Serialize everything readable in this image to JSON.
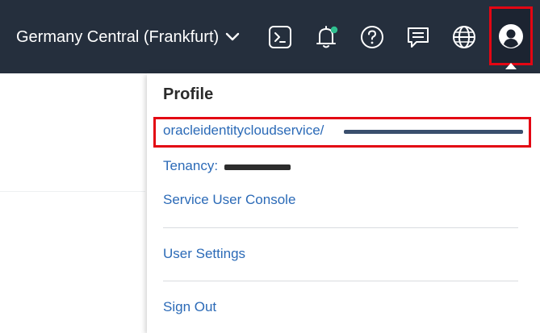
{
  "header": {
    "region_label": "Germany Central (Frankfurt)",
    "icons": [
      "cloud-shell-icon",
      "notifications-icon",
      "help-icon",
      "chat-icon",
      "language-icon",
      "profile-icon"
    ],
    "notification_dot_color": "#2fbf8f",
    "highlight_color": "#e30613"
  },
  "profile_menu": {
    "title": "Profile",
    "identity_prefix": "oracleidentitycloudservice/",
    "tenancy_label": "Tenancy:",
    "items": [
      {
        "label": "Service User Console"
      },
      {
        "label": "User Settings"
      },
      {
        "label": "Sign Out"
      }
    ]
  }
}
